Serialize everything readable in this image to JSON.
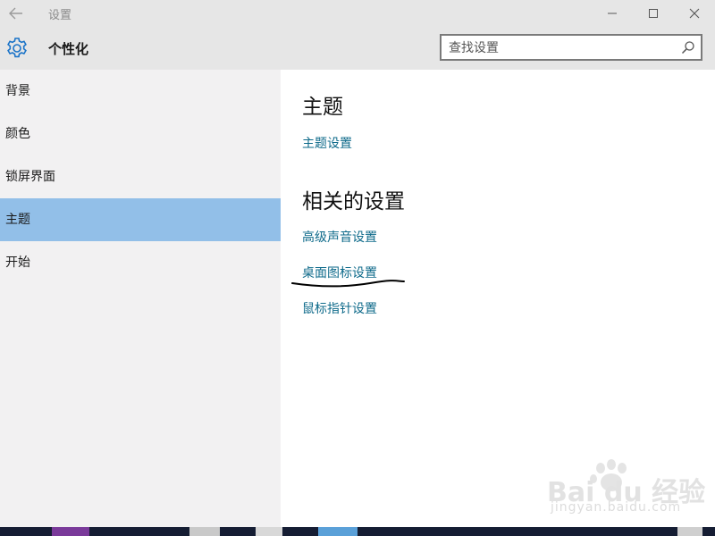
{
  "titlebar": {
    "title": "设置",
    "back_icon": "arrow-left-icon",
    "minimize_icon": "minimize-icon",
    "maximize_icon": "maximize-icon",
    "close_icon": "close-icon"
  },
  "header": {
    "icon": "gear-icon",
    "title": "个性化"
  },
  "search": {
    "placeholder": "查找设置",
    "icon": "search-icon"
  },
  "sidebar": {
    "items": [
      {
        "label": "背景",
        "selected": false
      },
      {
        "label": "颜色",
        "selected": false
      },
      {
        "label": "锁屏界面",
        "selected": false
      },
      {
        "label": "主题",
        "selected": true
      },
      {
        "label": "开始",
        "selected": false
      }
    ]
  },
  "content": {
    "theme_heading": "主题",
    "theme_settings_link": "主题设置",
    "related_heading": "相关的设置",
    "related_links": [
      "高级声音设置",
      "桌面图标设置",
      "鼠标指针设置"
    ]
  },
  "watermark": {
    "brand": "Bai du 经验",
    "url": "jingyan.baidu.com"
  },
  "colors": {
    "accent_link": "#0e6a8a",
    "selected_item_bg": "#92bfe8",
    "gear_icon": "#1a73c8"
  }
}
